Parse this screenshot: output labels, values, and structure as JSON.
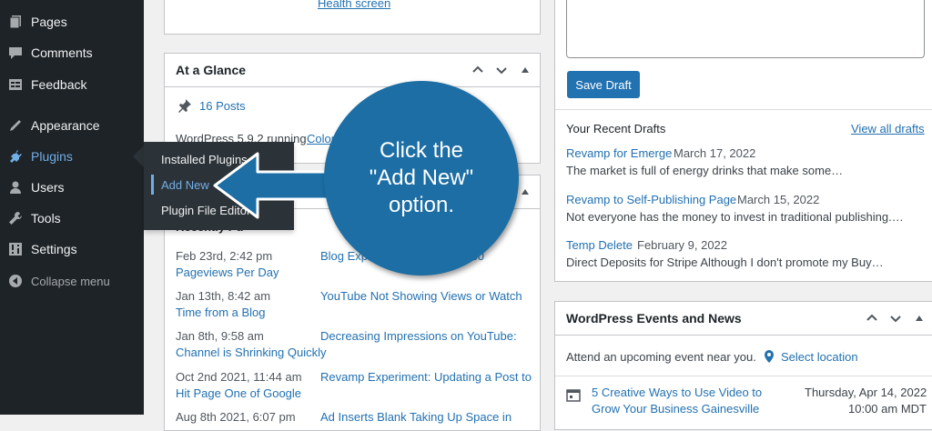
{
  "sidebar": {
    "items": [
      {
        "label": "Pages",
        "icon": "pages-icon"
      },
      {
        "label": "Comments",
        "icon": "comments-icon"
      },
      {
        "label": "Feedback",
        "icon": "feedback-icon"
      },
      {
        "label": "Appearance",
        "icon": "appearance-icon"
      },
      {
        "label": "Plugins",
        "icon": "plugins-icon"
      },
      {
        "label": "Users",
        "icon": "users-icon"
      },
      {
        "label": "Tools",
        "icon": "tools-icon"
      },
      {
        "label": "Settings",
        "icon": "settings-icon"
      }
    ],
    "collapse_label": "Collapse menu",
    "plugins_submenu": [
      "Installed Plugins",
      "Add New",
      "Plugin File Editor"
    ]
  },
  "left_col": {
    "health_link": "Health screen",
    "glance": {
      "title": "At a Glance",
      "posts_count": "16 Posts",
      "wp_running": "WordPress 5.9.2 running",
      "theme_link": "Colormag"
    },
    "activity": {
      "partial_header": "Recently Pu",
      "rows": [
        {
          "date": "Feb 23rd, 2:42 pm",
          "title_a": "Pageviews Per Day",
          "right": "Blog Experiments: Monthly 360"
        },
        {
          "date": "Jan 13th, 8:42 am",
          "title_a": "Time from a Blog",
          "right": "YouTube Not Showing Views or Watch"
        },
        {
          "date": "Jan 8th, 9:58 am",
          "title_a": "Channel is Shrinking Quickly",
          "right": "Decreasing Impressions on YouTube:"
        },
        {
          "date": "Oct 2nd 2021, 11:44 am",
          "title_a": "Hit Page One of Google",
          "right": "Revamp Experiment: Updating a Post to"
        },
        {
          "date": "Aug 8th 2021, 6:07 pm",
          "title_a": "",
          "right": "Ad Inserts Blank Taking Up Space in"
        }
      ]
    }
  },
  "right_col": {
    "save_draft": "Save Draft",
    "recent_drafts": {
      "title": "Your Recent Drafts",
      "view_all": "View all drafts",
      "items": [
        {
          "title": "Revamp for Emerge",
          "date": "March 17, 2022",
          "excerpt": "The market is full of energy drinks that make some…"
        },
        {
          "title": "Revamp to Self-Publishing Page",
          "date": "March 15, 2022",
          "excerpt": "Not everyone has the money to invest in traditional publishing.…"
        },
        {
          "title": "Temp Delete",
          "date": "February 9, 2022",
          "excerpt": "Direct Deposits for Stripe Although I don't promote my Buy…"
        }
      ]
    },
    "events": {
      "title": "WordPress Events and News",
      "attend": "Attend an upcoming event near you.",
      "select_location": "Select location",
      "event_title_1": "5 Creative Ways to Use Video to",
      "event_title_2": "Grow Your Business Gainesville",
      "event_date": "Thursday, Apr 14, 2022",
      "event_time": "10:00 am MDT"
    }
  },
  "callout": {
    "line1": "Click the",
    "line2": "\"Add New\"",
    "line3": "option."
  },
  "colors": {
    "sidebar_bg": "#1d2327",
    "flyout_bg": "#2c3338",
    "link": "#2271b1",
    "active": "#72aee6",
    "callout": "#1c6ea4"
  }
}
